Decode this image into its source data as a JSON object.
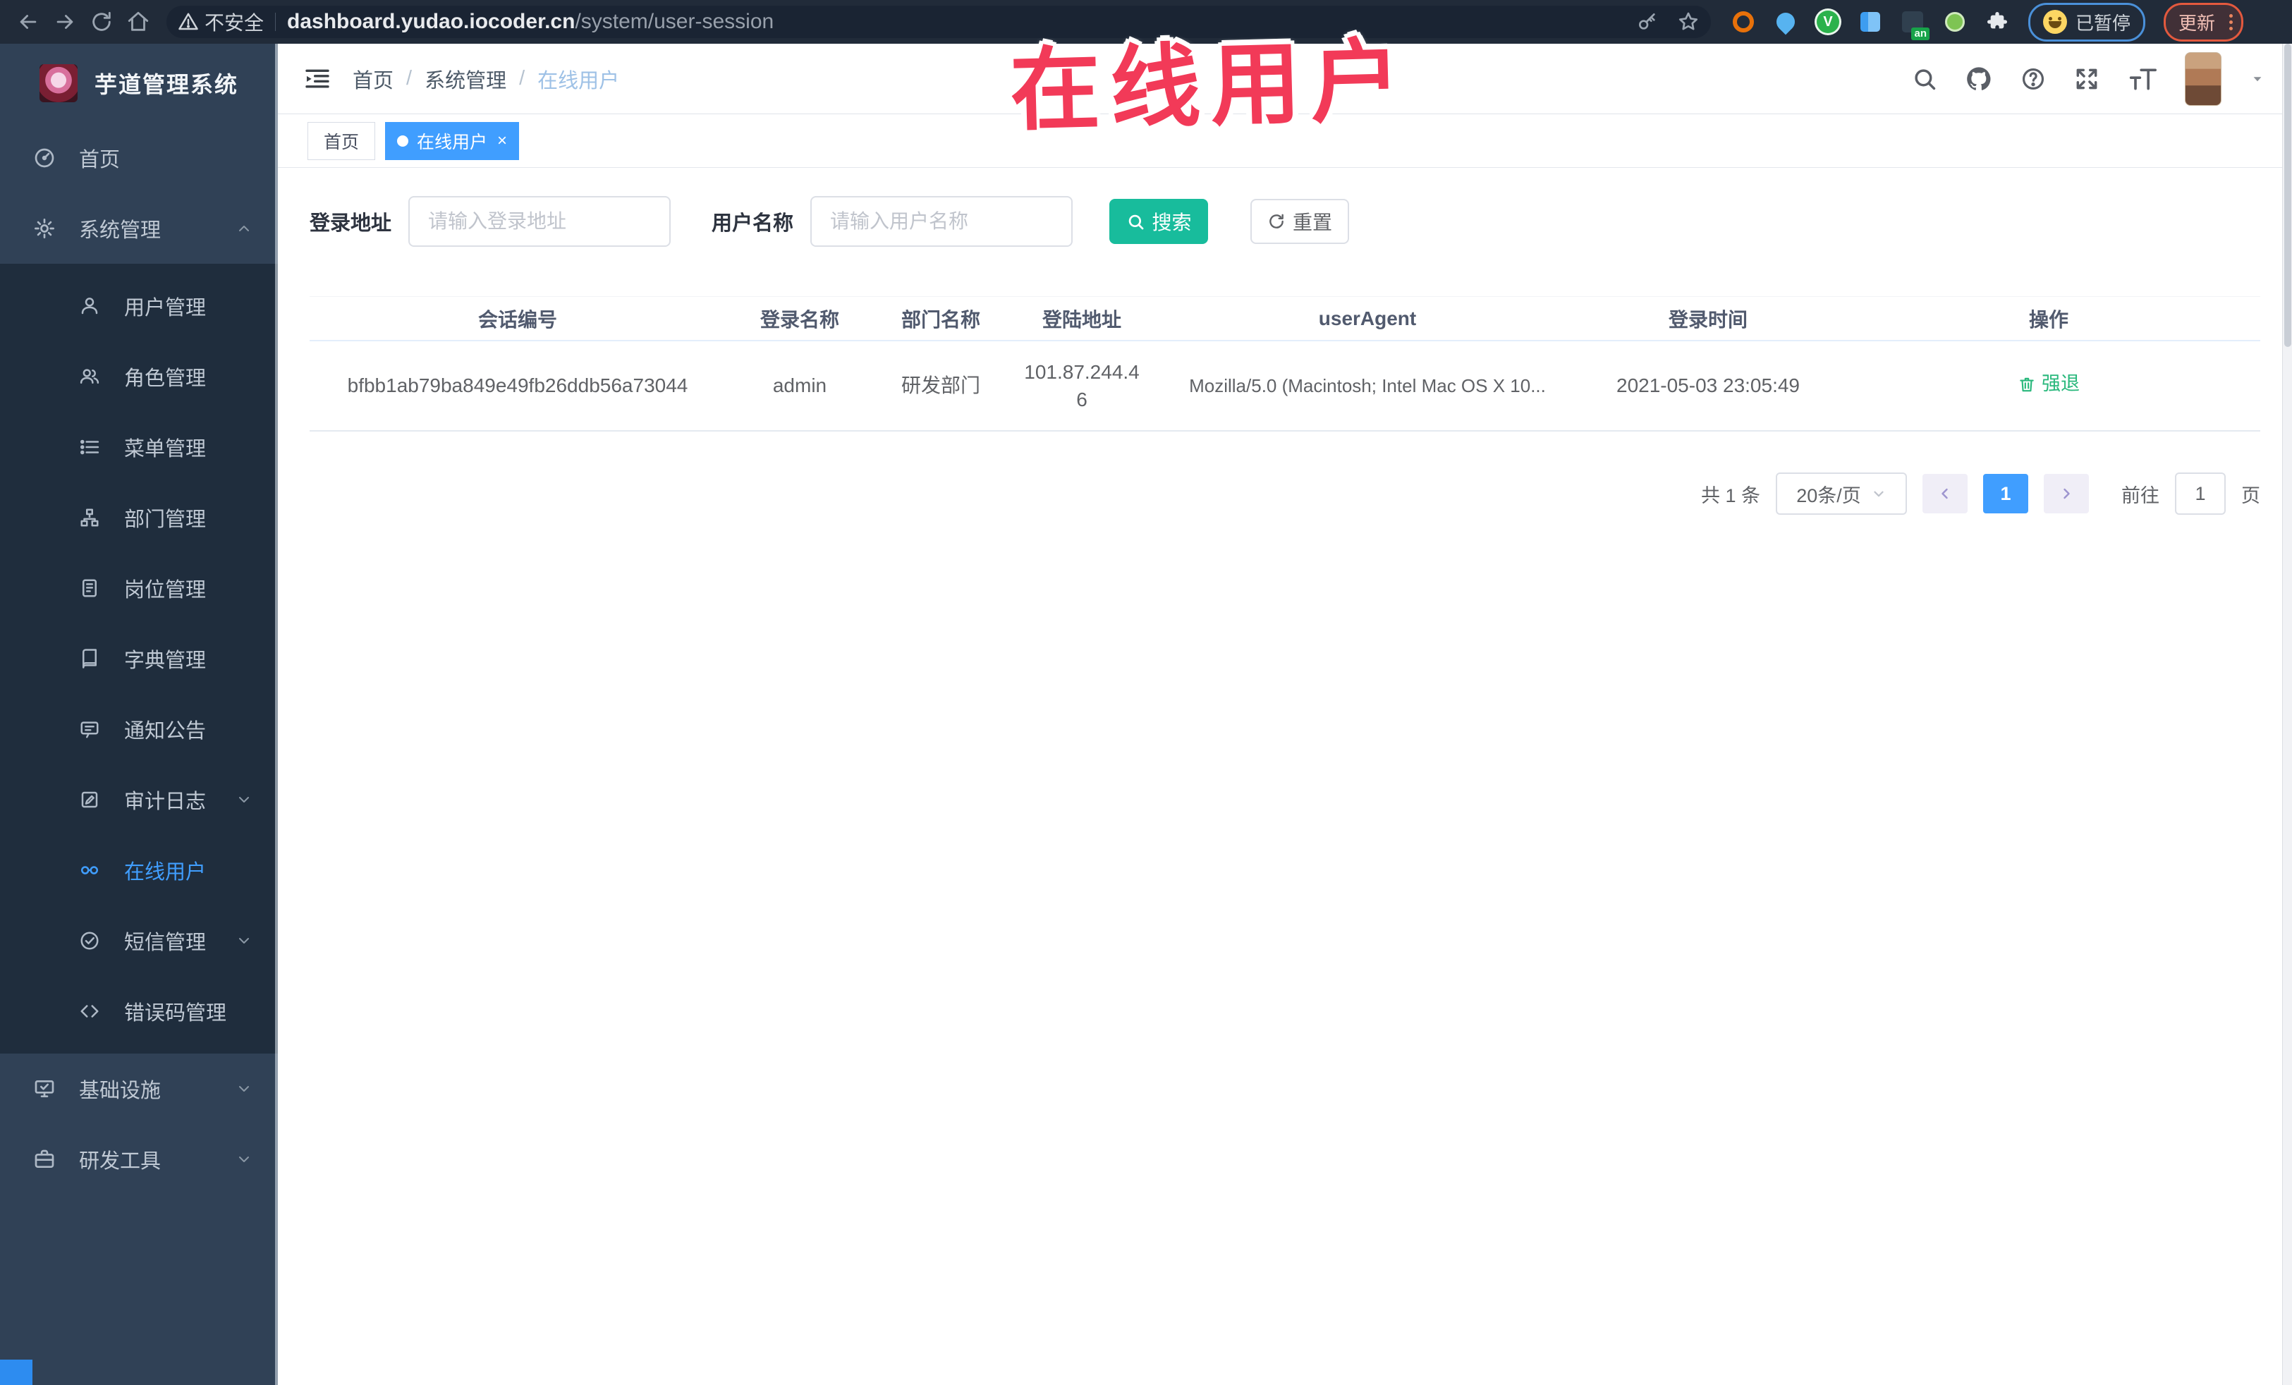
{
  "browser": {
    "security_label": "不安全",
    "url_host": "dashboard.yudao.iocoder.cn",
    "url_path": "/system/user-session",
    "ext_an_badge": "an",
    "paused_label": "已暂停",
    "update_label": "更新",
    "extension_icons": [
      "orange-ring",
      "blue-drop",
      "green-check",
      "blue-bars",
      "dark-an-badge",
      "green-search",
      "puzzle"
    ]
  },
  "sidebar": {
    "app_title": "芋道管理系统",
    "items": [
      {
        "label": "首页",
        "icon": "dashboard-icon"
      },
      {
        "label": "系统管理",
        "icon": "gear-icon",
        "chevron": "up"
      },
      {
        "label": "用户管理",
        "icon": "user-icon"
      },
      {
        "label": "角色管理",
        "icon": "users-icon"
      },
      {
        "label": "菜单管理",
        "icon": "menu-list-icon"
      },
      {
        "label": "部门管理",
        "icon": "org-tree-icon"
      },
      {
        "label": "岗位管理",
        "icon": "badge-icon"
      },
      {
        "label": "字典管理",
        "icon": "book-icon"
      },
      {
        "label": "通知公告",
        "icon": "announcement-icon"
      },
      {
        "label": "审计日志",
        "icon": "audit-log-icon",
        "chevron": "down"
      },
      {
        "label": "在线用户",
        "icon": "online-user-icon",
        "active": true
      },
      {
        "label": "短信管理",
        "icon": "sms-icon",
        "chevron": "down"
      },
      {
        "label": "错误码管理",
        "icon": "code-icon"
      },
      {
        "label": "基础设施",
        "icon": "infrastructure-icon",
        "chevron": "down"
      },
      {
        "label": "研发工具",
        "icon": "dev-tools-icon",
        "chevron": "down"
      }
    ]
  },
  "header": {
    "breadcrumb": [
      "首页",
      "系统管理",
      "在线用户"
    ],
    "separator": "/"
  },
  "tabs": [
    {
      "label": "首页",
      "active": false
    },
    {
      "label": "在线用户",
      "active": true,
      "close_glyph": "×"
    }
  ],
  "watermark": "在线用户",
  "search": {
    "address_label": "登录地址",
    "address_placeholder": "请输入登录地址",
    "username_label": "用户名称",
    "username_placeholder": "请输入用户名称",
    "search_button": "搜索",
    "reset_button": "重置"
  },
  "table": {
    "headers": [
      "会话编号",
      "登录名称",
      "部门名称",
      "登陆地址",
      "userAgent",
      "登录时间",
      "操作"
    ],
    "rows": [
      {
        "session_id": "bfbb1ab79ba849e49fb26ddb56a73044",
        "username": "admin",
        "dept": "研发部门",
        "ip": "101.87.244.46",
        "user_agent": "Mozilla/5.0 (Macintosh; Intel Mac OS X 10...",
        "login_time": "2021-05-03 23:05:49",
        "action": "强退"
      }
    ]
  },
  "pagination": {
    "total": "共 1 条",
    "page_size": "20条/页",
    "current_page": "1",
    "goto_label": "前往",
    "goto_value": "1",
    "page_label": "页"
  },
  "colors": {
    "accent_blue": "#409eff",
    "search_teal": "#18bc9c",
    "action_green": "#29b87c",
    "watermark_red": "#f23a58",
    "sidebar_bg": "#304156",
    "submenu_bg": "#1f2d3d",
    "chrome_bg": "#212b39"
  }
}
